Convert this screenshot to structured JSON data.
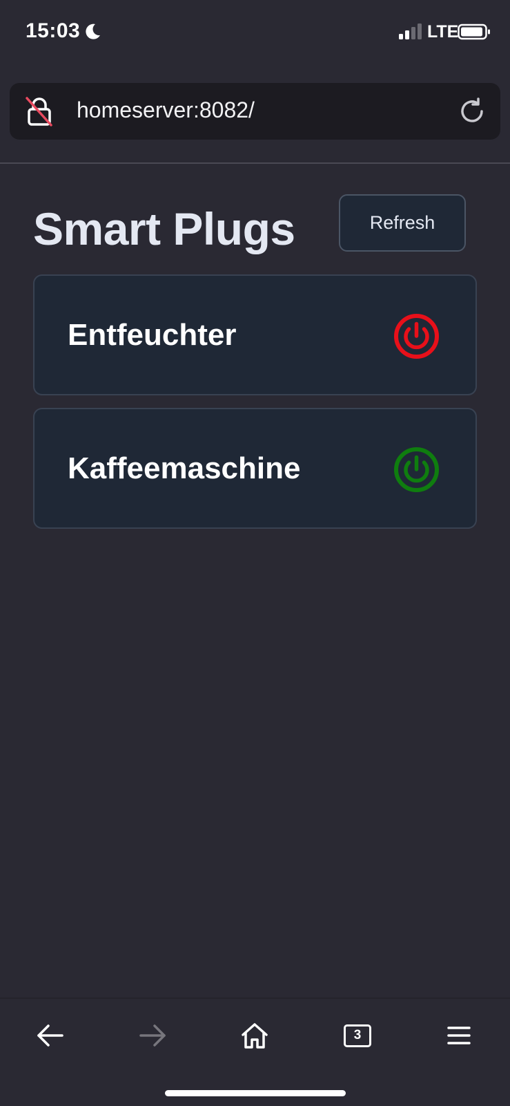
{
  "status_bar": {
    "time": "15:03",
    "network": "LTE",
    "icons": [
      "moon-icon",
      "cellular-signal-icon",
      "battery-icon"
    ]
  },
  "browser": {
    "url": "homeserver:8082/",
    "lock_icon": "insecure-lock-icon",
    "reload_icon": "reload-icon"
  },
  "page": {
    "title": "Smart Plugs",
    "refresh_label": "Refresh",
    "plugs": [
      {
        "name": "Entfeuchter",
        "state": "off",
        "icon": "power-icon",
        "color": "#e8101a"
      },
      {
        "name": "Kaffeemaschine",
        "state": "on",
        "icon": "power-icon",
        "color": "#0f7d0f"
      }
    ]
  },
  "toolbar": {
    "tab_count": "3",
    "icons": [
      "back-arrow-icon",
      "forward-arrow-icon",
      "home-icon",
      "tabs-icon",
      "menu-icon"
    ]
  },
  "colors": {
    "background": "#2a2933",
    "card": "#1f2836",
    "url_bar": "#1c1b21",
    "title": "#e4e8f2"
  }
}
